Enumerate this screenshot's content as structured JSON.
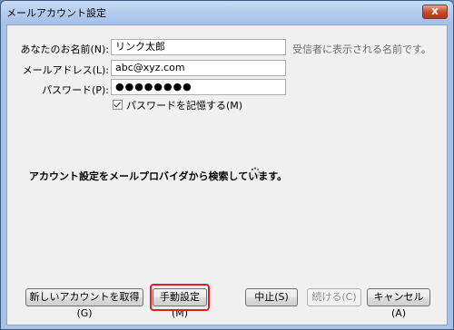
{
  "window": {
    "title": "メールアカウント設定",
    "close_label": "x"
  },
  "form": {
    "name_label": "あなたのお名前(N):",
    "name_value": "リンク太郎",
    "name_hint": "受信者に表示される名前です。",
    "email_label": "メールアドレス(L):",
    "email_value": "abc@xyz.com",
    "password_label": "パスワード(P):",
    "password_value": "●●●●●●●●",
    "remember_label": "パスワードを記憶する(M)",
    "remember_checked": true
  },
  "status": {
    "text": "アカウント設定をメールプロバイダから検索しています。"
  },
  "buttons": {
    "new_account": "新しいアカウントを取得(G)",
    "manual": "手動設定(M)",
    "stop": "中止(S)",
    "continue": "続ける(C)",
    "cancel": "キャンセル(A)"
  },
  "colors": {
    "highlight": "#e02020",
    "titlebar": "#a6c2e8",
    "close": "#c8472b"
  }
}
